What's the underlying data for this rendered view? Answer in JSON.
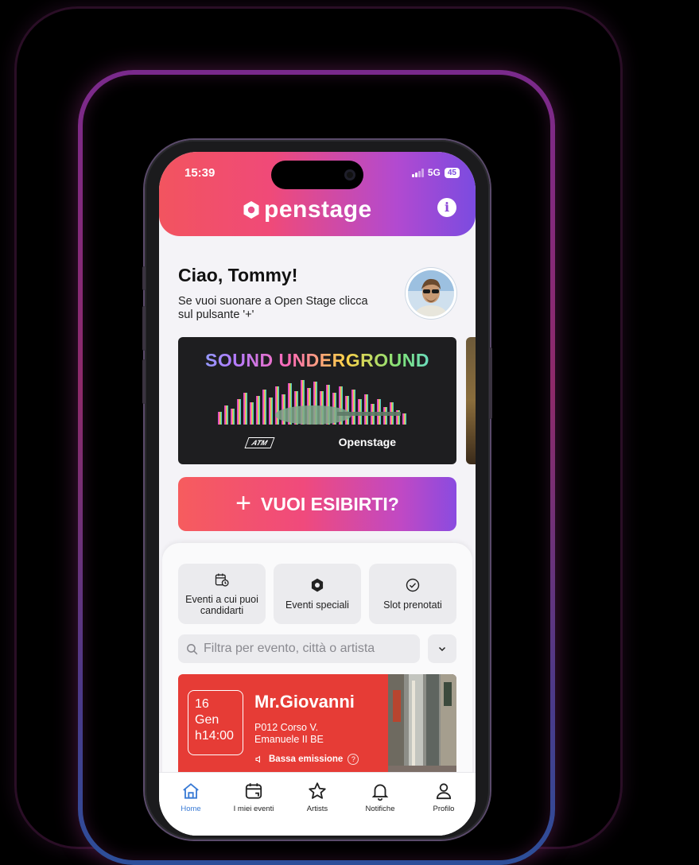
{
  "status_bar": {
    "time": "15:39",
    "network": "5G",
    "battery": "45"
  },
  "header": {
    "logo": "penstage",
    "info_icon": "info-icon"
  },
  "greeting": {
    "title": "Ciao, Tommy!",
    "subtitle": "Se vuoi suonare a Open Stage clicca sul pulsante '+'"
  },
  "banner": {
    "title": "SOUND UNDERGROUND",
    "brand": "Openstage",
    "partner": "ATM"
  },
  "cta": {
    "plus": "+",
    "label": "VUOI ESIBIRTI?"
  },
  "categories": [
    {
      "label": "Eventi a cui puoi candidarti",
      "icon": "calendar-clock-icon"
    },
    {
      "label": "Eventi speciali",
      "icon": "openstage-badge-icon"
    },
    {
      "label": "Slot prenotati",
      "icon": "check-circle-icon"
    }
  ],
  "search": {
    "placeholder": "Filtra per evento, città o artista"
  },
  "event": {
    "day": "16",
    "month": "Gen",
    "time": "h14:00",
    "title": "Mr.Giovanni",
    "address": "P012 Corso V. Emanuele II BE",
    "eco_label": "Bassa emissione",
    "eco_help": "?"
  },
  "tabs": [
    {
      "label": "Home",
      "icon": "home-icon",
      "active": true
    },
    {
      "label": "I miei eventi",
      "icon": "calendar-icon",
      "active": false
    },
    {
      "label": "Artists",
      "icon": "star-icon",
      "active": false
    },
    {
      "label": "Notifiche",
      "icon": "bell-icon",
      "active": false
    },
    {
      "label": "Profilo",
      "icon": "profile-icon",
      "active": false
    }
  ],
  "colors": {
    "accent_red": "#f2545f",
    "accent_purple": "#7b4be0",
    "event_red": "#e63c36",
    "tab_active": "#3a7bd5"
  }
}
